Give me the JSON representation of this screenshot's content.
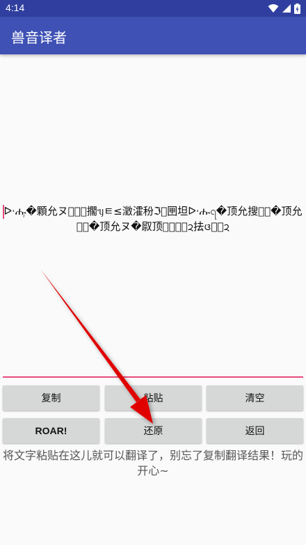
{
  "status_bar": {
    "time": "4:14",
    "icons": [
      "wifi-icon",
      "signal-icon",
      "battery-icon"
    ]
  },
  "app_bar": {
    "title": "兽音译者"
  },
  "editor": {
    "text": "ᐅ·ሑ᷊�顆允ヌㅋ᷊᷊擱ᥡㅌ≤澂瀖秎ℑ᷊㘡坦ᐅ·ሑ꩹�顶允搜ᦞ᷊�顶允搜᷊�顶允ヌ�叞顶允᷊ㅈ᷊ᨯ抾ᨴㅋ᷊ᨯ"
  },
  "buttons": {
    "copy": "复制",
    "paste": "粘贴",
    "clear": "清空",
    "roar": "ROAR!",
    "restore": "还原",
    "back": "返回"
  },
  "hint": "将文字粘贴在这儿就可以翻译了，别忘了复制翻译结果！玩的开心~",
  "colors": {
    "status_bar": "#303f9f",
    "app_bar": "#3f51b5",
    "underline": "#e84a7a",
    "button": "#d6d7d7",
    "arrow": "#e00000"
  }
}
